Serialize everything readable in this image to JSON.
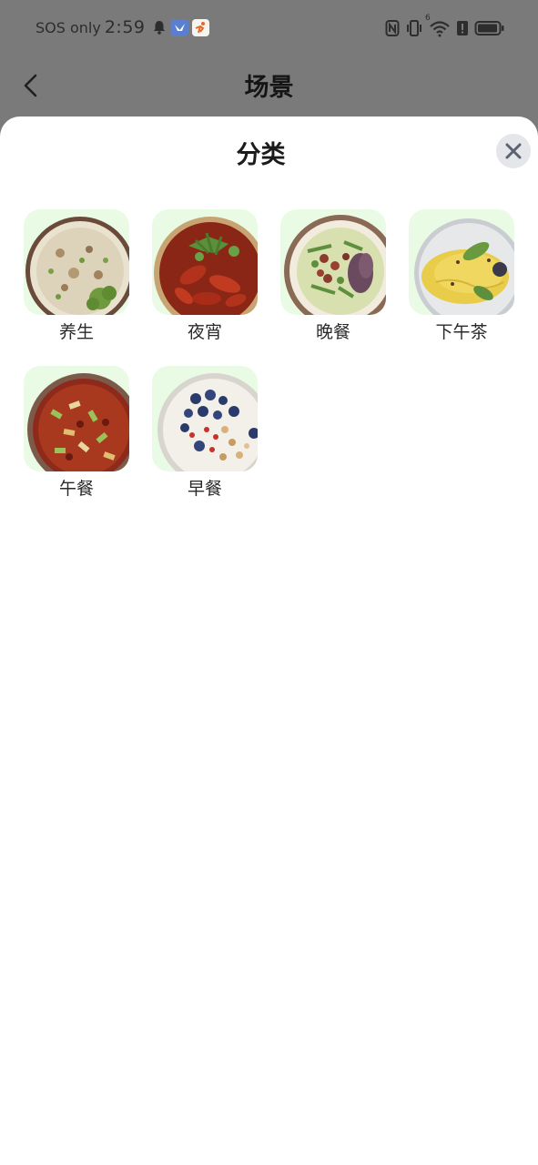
{
  "status_bar": {
    "carrier": "SOS only",
    "time": "2:59",
    "icons": [
      "bell-icon",
      "app-badge-blue",
      "app-badge-orange",
      "nfc-icon",
      "vibrate-icon",
      "wifi-icon",
      "alert-icon",
      "battery-icon"
    ],
    "wifi_label": "6"
  },
  "navbar": {
    "title": "场景",
    "back_icon": "chevron-left-icon"
  },
  "sheet": {
    "title": "分类",
    "close_icon": "close-icon"
  },
  "categories": [
    {
      "label": "养生"
    },
    {
      "label": "夜宵"
    },
    {
      "label": "晚餐"
    },
    {
      "label": "下午茶"
    },
    {
      "label": "午餐"
    },
    {
      "label": "早餐"
    }
  ],
  "colors": {
    "overlay": "#7a7a7a",
    "sheet_bg": "#ffffff",
    "tile_bg": "#eafbe5",
    "close_bg": "#e4e6ea"
  }
}
